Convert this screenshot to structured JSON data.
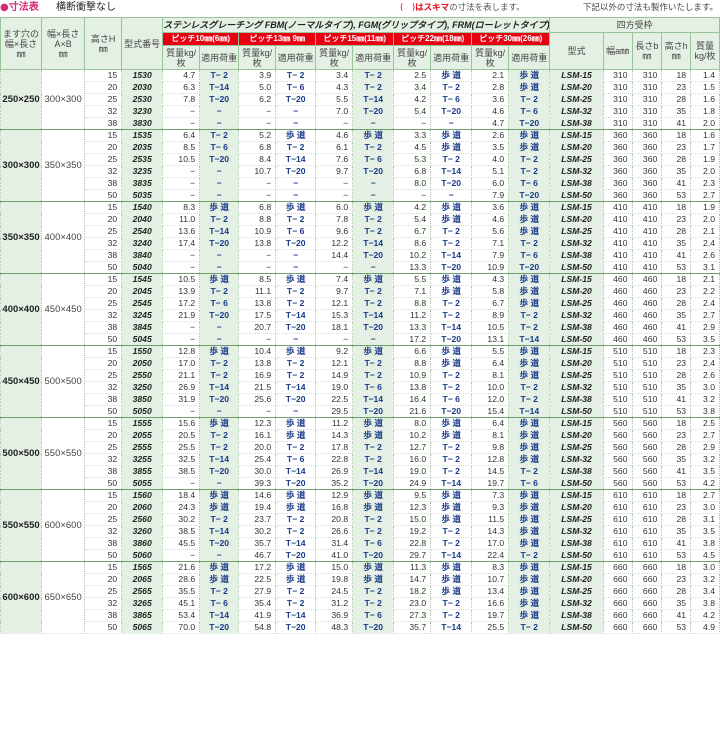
{
  "header": {
    "title": "●寸法表",
    "subtitle": "横断衝撃なし",
    "note_mark": "(　)",
    "note_mark_text": "はスキマ",
    "note_rest": "の寸法を表します。",
    "other_note": "下記以外の寸法も製作いたします。"
  },
  "columns": {
    "pit": "ます穴の幅×長さ",
    "pit_unit": "㎜",
    "frame_outer": "幅×長さA×B",
    "frame_outer_unit": "㎜",
    "height": "高さH",
    "height_unit": "㎜",
    "model": "型式番号",
    "stainless_title": "ステンレスグレーチング FBM(ノーマルタイプ), FGM(グリップタイプ), FRM(ローレットタイプ)",
    "pitches": [
      {
        "label": "ピッチ10㎜(6㎜)",
        "mass": "質量kg/枚",
        "load": "適用荷重"
      },
      {
        "label": "ピッチ13㎜ 9㎜",
        "mass": "質量kg/枚",
        "load": "適用荷重"
      },
      {
        "label": "ピッチ15㎜(11㎜)",
        "mass": "質量kg/枚",
        "load": "適用荷重"
      },
      {
        "label": "ピッチ22㎜(18㎜)",
        "mass": "質量kg/枚",
        "load": "適用荷重"
      },
      {
        "label": "ピッチ30㎜(26㎜)",
        "mass": "質量kg/枚",
        "load": "適用荷重"
      }
    ],
    "frame_title": "四方受枠",
    "frame_cols": [
      "型式",
      "幅a㎜",
      "長さb㎜",
      "高さh㎜",
      "質量kg/枚"
    ]
  },
  "groups": [
    {
      "pit": "250×250",
      "ab": "300×300",
      "rows": [
        [
          "15",
          "1530",
          "4.7",
          "T− 2",
          "3.9",
          "T− 2",
          "3.4",
          "T− 2",
          "2.5",
          "歩 道",
          "2.1",
          "歩 道",
          "LSM-15",
          "310",
          "310",
          "18",
          "1.4"
        ],
        [
          "20",
          "2030",
          "6.3",
          "T−14",
          "5.0",
          "T− 6",
          "4.3",
          "T− 2",
          "3.4",
          "T− 2",
          "2.8",
          "歩 道",
          "LSM-20",
          "310",
          "310",
          "23",
          "1.5"
        ],
        [
          "25",
          "2530",
          "7.8",
          "T−20",
          "6.2",
          "T−20",
          "5.5",
          "T−14",
          "4.2",
          "T− 6",
          "3.6",
          "T− 2",
          "LSM-25",
          "310",
          "310",
          "28",
          "1.6"
        ],
        [
          "32",
          "3230",
          "−",
          "−",
          "−",
          "−",
          "7.0",
          "T−20",
          "5.4",
          "T−20",
          "4.6",
          "T− 6",
          "LSM-32",
          "310",
          "310",
          "35",
          "1.8"
        ],
        [
          "38",
          "3830",
          "−",
          "−",
          "−",
          "−",
          "−",
          "−",
          "−",
          "−",
          "4.7",
          "T−20",
          "LSM-38",
          "310",
          "310",
          "41",
          "2.0"
        ]
      ]
    },
    {
      "pit": "300×300",
      "ab": "350×350",
      "rows": [
        [
          "15",
          "1535",
          "6.4",
          "T− 2",
          "5.2",
          "歩 道",
          "4.6",
          "歩 道",
          "3.3",
          "歩 道",
          "2.6",
          "歩 道",
          "LSM-15",
          "360",
          "360",
          "18",
          "1.6"
        ],
        [
          "20",
          "2035",
          "8.5",
          "T− 6",
          "6.8",
          "T− 2",
          "6.1",
          "T− 2",
          "4.5",
          "歩 道",
          "3.5",
          "歩 道",
          "LSM-20",
          "360",
          "360",
          "23",
          "1.7"
        ],
        [
          "25",
          "2535",
          "10.5",
          "T−20",
          "8.4",
          "T−14",
          "7.6",
          "T− 6",
          "5.3",
          "T− 2",
          "4.0",
          "T− 2",
          "LSM-25",
          "360",
          "360",
          "28",
          "1.9"
        ],
        [
          "32",
          "3235",
          "−",
          "−",
          "10.7",
          "T−20",
          "9.7",
          "T−20",
          "6.8",
          "T−14",
          "5.1",
          "T− 2",
          "LSM-32",
          "360",
          "360",
          "35",
          "2.0"
        ],
        [
          "38",
          "3835",
          "−",
          "−",
          "−",
          "−",
          "−",
          "−",
          "8.0",
          "T−20",
          "6.0",
          "T− 6",
          "LSM-38",
          "360",
          "360",
          "41",
          "2.3"
        ],
        [
          "50",
          "5035",
          "−",
          "−",
          "−",
          "−",
          "−",
          "−",
          "−",
          "−",
          "7.9",
          "T−20",
          "LSM-50",
          "360",
          "360",
          "53",
          "2.7"
        ]
      ]
    },
    {
      "pit": "350×350",
      "ab": "400×400",
      "rows": [
        [
          "15",
          "1540",
          "8.3",
          "歩 道",
          "6.8",
          "歩 道",
          "6.0",
          "歩 道",
          "4.2",
          "歩 道",
          "3.6",
          "歩 道",
          "LSM-15",
          "410",
          "410",
          "18",
          "1.9"
        ],
        [
          "20",
          "2040",
          "11.0",
          "T− 2",
          "8.8",
          "T− 2",
          "7.8",
          "T− 2",
          "5.4",
          "歩 道",
          "4.6",
          "歩 道",
          "LSM-20",
          "410",
          "410",
          "23",
          "2.0"
        ],
        [
          "25",
          "2540",
          "13.6",
          "T−14",
          "10.9",
          "T− 6",
          "9.6",
          "T− 2",
          "6.7",
          "T− 2",
          "5.6",
          "歩 道",
          "LSM-25",
          "410",
          "410",
          "28",
          "2.1"
        ],
        [
          "32",
          "3240",
          "17.4",
          "T−20",
          "13.8",
          "T−20",
          "12.2",
          "T−14",
          "8.6",
          "T− 2",
          "7.1",
          "T− 2",
          "LSM-32",
          "410",
          "410",
          "35",
          "2.4"
        ],
        [
          "38",
          "3840",
          "−",
          "−",
          "−",
          "−",
          "14.4",
          "T−20",
          "10.2",
          "T−14",
          "7.9",
          "T− 6",
          "LSM-38",
          "410",
          "410",
          "41",
          "2.6"
        ],
        [
          "50",
          "5040",
          "−",
          "−",
          "−",
          "−",
          "−",
          "−",
          "13.3",
          "T−20",
          "10.9",
          "T−20",
          "LSM-50",
          "410",
          "410",
          "53",
          "3.1"
        ]
      ]
    },
    {
      "pit": "400×400",
      "ab": "450×450",
      "rows": [
        [
          "15",
          "1545",
          "10.5",
          "歩 道",
          "8.5",
          "歩 道",
          "7.4",
          "歩 道",
          "5.5",
          "歩 道",
          "4.3",
          "歩 道",
          "LSM-15",
          "460",
          "460",
          "18",
          "2.1"
        ],
        [
          "20",
          "2045",
          "13.9",
          "T− 2",
          "11.1",
          "T− 2",
          "9.7",
          "T− 2",
          "7.1",
          "歩 道",
          "5.8",
          "歩 道",
          "LSM-20",
          "460",
          "460",
          "23",
          "2.2"
        ],
        [
          "25",
          "2545",
          "17.2",
          "T− 6",
          "13.8",
          "T− 2",
          "12.1",
          "T− 2",
          "8.8",
          "T− 2",
          "6.7",
          "歩 道",
          "LSM-25",
          "460",
          "460",
          "28",
          "2.4"
        ],
        [
          "32",
          "3245",
          "21.9",
          "T−20",
          "17.5",
          "T−14",
          "15.3",
          "T−14",
          "11.2",
          "T− 2",
          "8.9",
          "T− 2",
          "LSM-32",
          "460",
          "460",
          "35",
          "2.7"
        ],
        [
          "38",
          "3845",
          "−",
          "−",
          "20.7",
          "T−20",
          "18.1",
          "T−20",
          "13.3",
          "T−14",
          "10.5",
          "T− 2",
          "LSM-38",
          "460",
          "460",
          "41",
          "2.9"
        ],
        [
          "50",
          "5045",
          "−",
          "−",
          "−",
          "−",
          "−",
          "−",
          "17.2",
          "T−20",
          "13.1",
          "T−14",
          "LSM-50",
          "460",
          "460",
          "53",
          "3.5"
        ]
      ]
    },
    {
      "pit": "450×450",
      "ab": "500×500",
      "rows": [
        [
          "15",
          "1550",
          "12.8",
          "歩 道",
          "10.4",
          "歩 道",
          "9.2",
          "歩 道",
          "6.6",
          "歩 道",
          "5.5",
          "歩 道",
          "LSM-15",
          "510",
          "510",
          "18",
          "2.3"
        ],
        [
          "20",
          "2050",
          "17.0",
          "T− 2",
          "13.8",
          "T− 2",
          "12.1",
          "T− 2",
          "8.8",
          "歩 道",
          "6.4",
          "歩 道",
          "LSM-20",
          "510",
          "510",
          "23",
          "2.4"
        ],
        [
          "25",
          "2550",
          "21.1",
          "T− 2",
          "16.9",
          "T− 2",
          "14.9",
          "T− 2",
          "10.9",
          "T− 2",
          "8.1",
          "歩 道",
          "LSM-25",
          "510",
          "510",
          "28",
          "2.6"
        ],
        [
          "32",
          "3250",
          "26.9",
          "T−14",
          "21.5",
          "T−14",
          "19.0",
          "T− 6",
          "13.8",
          "T− 2",
          "10.0",
          "T− 2",
          "LSM-32",
          "510",
          "510",
          "35",
          "3.0"
        ],
        [
          "38",
          "3850",
          "31.9",
          "T−20",
          "25.6",
          "T−20",
          "22.5",
          "T−14",
          "16.4",
          "T− 6",
          "12.0",
          "T− 2",
          "LSM-38",
          "510",
          "510",
          "41",
          "3.2"
        ],
        [
          "50",
          "5050",
          "−",
          "−",
          "−",
          "−",
          "29.5",
          "T−20",
          "21.6",
          "T−20",
          "15.4",
          "T−14",
          "LSM-50",
          "510",
          "510",
          "53",
          "3.8"
        ]
      ]
    },
    {
      "pit": "500×500",
      "ab": "550×550",
      "rows": [
        [
          "15",
          "1555",
          "15.6",
          "歩 道",
          "12.3",
          "歩 道",
          "11.2",
          "歩 道",
          "8.0",
          "歩 道",
          "6.4",
          "歩 道",
          "LSM-15",
          "560",
          "560",
          "18",
          "2.5"
        ],
        [
          "20",
          "2055",
          "20.5",
          "T− 2",
          "16.1",
          "歩 道",
          "14.3",
          "歩 道",
          "10.2",
          "歩 道",
          "8.1",
          "歩 道",
          "LSM-20",
          "560",
          "560",
          "23",
          "2.7"
        ],
        [
          "25",
          "2555",
          "25.5",
          "T− 2",
          "20.0",
          "T− 2",
          "17.8",
          "T− 2",
          "12.7",
          "T− 2",
          "9.8",
          "歩 道",
          "LSM-25",
          "560",
          "560",
          "28",
          "2.9"
        ],
        [
          "32",
          "3255",
          "32.5",
          "T−14",
          "25.4",
          "T− 6",
          "22.8",
          "T− 2",
          "16.0",
          "T− 2",
          "12.8",
          "歩 道",
          "LSM-32",
          "560",
          "560",
          "35",
          "3.2"
        ],
        [
          "38",
          "3855",
          "38.5",
          "T−20",
          "30.0",
          "T−14",
          "26.9",
          "T−14",
          "19.0",
          "T− 2",
          "14.5",
          "T− 2",
          "LSM-38",
          "560",
          "560",
          "41",
          "3.5"
        ],
        [
          "50",
          "5055",
          "−",
          "−",
          "39.3",
          "T−20",
          "35.2",
          "T−20",
          "24.9",
          "T−14",
          "19.7",
          "T− 6",
          "LSM-50",
          "560",
          "560",
          "53",
          "4.2"
        ]
      ]
    },
    {
      "pit": "550×550",
      "ab": "600×600",
      "rows": [
        [
          "15",
          "1560",
          "18.4",
          "歩 道",
          "14.6",
          "歩 道",
          "12.9",
          "歩 道",
          "9.5",
          "歩 道",
          "7.3",
          "歩 道",
          "LSM-15",
          "610",
          "610",
          "18",
          "2.7"
        ],
        [
          "20",
          "2060",
          "24.3",
          "歩 道",
          "19.4",
          "歩 道",
          "16.8",
          "歩 道",
          "12.3",
          "歩 道",
          "9.3",
          "歩 道",
          "LSM-20",
          "610",
          "610",
          "23",
          "3.0"
        ],
        [
          "25",
          "2560",
          "30.2",
          "T− 2",
          "23.7",
          "T− 2",
          "20.8",
          "T− 2",
          "15.0",
          "歩 道",
          "11.5",
          "歩 道",
          "LSM-25",
          "610",
          "610",
          "28",
          "3.1"
        ],
        [
          "32",
          "3260",
          "38.5",
          "T−14",
          "30.2",
          "T− 2",
          "26.6",
          "T− 2",
          "19.2",
          "T− 2",
          "14.3",
          "歩 道",
          "LSM-32",
          "610",
          "610",
          "35",
          "3.5"
        ],
        [
          "38",
          "3860",
          "45.5",
          "T−20",
          "35.7",
          "T−14",
          "31.4",
          "T− 6",
          "22.8",
          "T− 2",
          "17.0",
          "歩 道",
          "LSM-38",
          "610",
          "610",
          "41",
          "3.8"
        ],
        [
          "50",
          "5060",
          "−",
          "−",
          "46.7",
          "T−20",
          "41.0",
          "T−20",
          "29.7",
          "T−14",
          "22.4",
          "T− 2",
          "LSM-50",
          "610",
          "610",
          "53",
          "4.5"
        ]
      ]
    },
    {
      "pit": "600×600",
      "ab": "650×650",
      "rows": [
        [
          "15",
          "1565",
          "21.6",
          "歩 道",
          "17.2",
          "歩 道",
          "15.0",
          "歩 道",
          "11.3",
          "歩 道",
          "8.3",
          "歩 道",
          "LSM-15",
          "660",
          "660",
          "18",
          "3.0"
        ],
        [
          "20",
          "2065",
          "28.6",
          "歩 道",
          "22.5",
          "歩 道",
          "19.8",
          "歩 道",
          "14.7",
          "歩 道",
          "10.7",
          "歩 道",
          "LSM-20",
          "660",
          "660",
          "23",
          "3.2"
        ],
        [
          "25",
          "2565",
          "35.5",
          "T− 2",
          "27.9",
          "T− 2",
          "24.5",
          "T− 2",
          "18.2",
          "歩 道",
          "13.4",
          "歩 道",
          "LSM-25",
          "660",
          "660",
          "28",
          "3.4"
        ],
        [
          "32",
          "3265",
          "45.1",
          "T− 6",
          "35.4",
          "T− 2",
          "31.2",
          "T− 2",
          "23.0",
          "T− 2",
          "16.6",
          "歩 道",
          "LSM-32",
          "660",
          "660",
          "35",
          "3.8"
        ],
        [
          "38",
          "3865",
          "53.4",
          "T−14",
          "41.9",
          "T−14",
          "36.9",
          "T− 6",
          "27.3",
          "T− 2",
          "19.7",
          "歩 道",
          "LSM-38",
          "660",
          "660",
          "41",
          "4.2"
        ],
        [
          "50",
          "5065",
          "70.0",
          "T−20",
          "54.8",
          "T−20",
          "48.3",
          "T−20",
          "35.7",
          "T−14",
          "25.5",
          "T− 2",
          "LSM-50",
          "660",
          "660",
          "53",
          "4.9"
        ]
      ]
    }
  ]
}
